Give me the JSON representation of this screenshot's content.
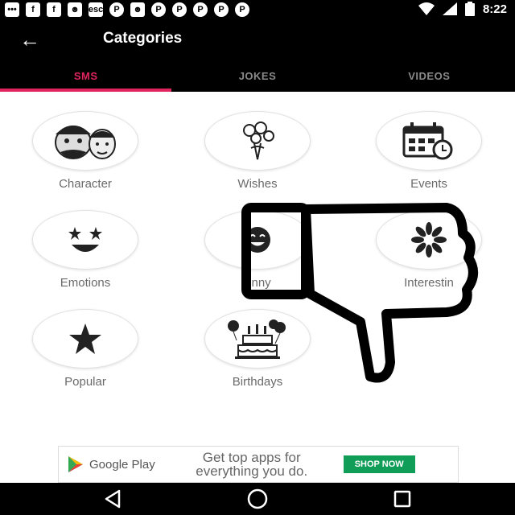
{
  "status": {
    "time": "8:22",
    "esc_icon": "esc",
    "battery_icon": "battery-icon",
    "wifi_icon": "wifi-icon"
  },
  "header": {
    "title": "Categories",
    "back_icon": "arrow-left-icon"
  },
  "tabs": [
    {
      "label": "SMS",
      "active": true
    },
    {
      "label": "JOKES",
      "active": false
    },
    {
      "label": "VIDEOS",
      "active": false
    }
  ],
  "categories": [
    {
      "label": "Character",
      "icon": "character-faces-icon"
    },
    {
      "label": "Wishes",
      "icon": "bouquet-icon"
    },
    {
      "label": "Events",
      "icon": "calendar-clock-icon"
    },
    {
      "label": "Emotions",
      "icon": "starry-eyes-icon"
    },
    {
      "label": "Fnny",
      "icon": "laughing-face-icon"
    },
    {
      "label": "Interestin",
      "icon": "flower-icon"
    },
    {
      "label": "Popular",
      "icon": "star-icon"
    },
    {
      "label": "Birthdays",
      "icon": "birthday-cake-icon"
    }
  ],
  "ad": {
    "store": "Google Play",
    "line1": "Get top apps for",
    "line2": "everything you do.",
    "cta": "SHOP NOW"
  },
  "colors": {
    "accent": "#e0245e",
    "cta": "#0f9d58"
  }
}
